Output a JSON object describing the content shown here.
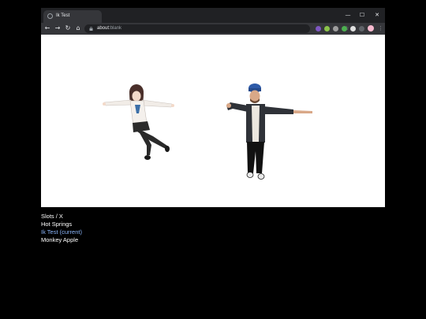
{
  "browser": {
    "tab_title": "Ik Test",
    "url_host": "about:",
    "url_path": "blank",
    "window_controls": {
      "minimize": "—",
      "maximize": "☐",
      "close": "✕"
    },
    "nav": {
      "back": "←",
      "forward": "→",
      "reload": "↻",
      "home": "⌂"
    },
    "star": "☆",
    "menu": "⋮",
    "extensions": [
      {
        "name": "ext-purple",
        "color": "#7e57c2"
      },
      {
        "name": "ext-green",
        "color": "#8bc34a"
      },
      {
        "name": "ext-gray",
        "color": "#9e9e9e"
      },
      {
        "name": "ext-green2",
        "color": "#4caf50"
      },
      {
        "name": "ext-white",
        "color": "#e0e0e0"
      },
      {
        "name": "ext-dark",
        "color": "#5f6368"
      },
      {
        "name": "ext-profile",
        "color": "#f8bbd0"
      }
    ]
  },
  "scene": {
    "background": "#ffffff",
    "avatars": [
      "anime-girl-avatar",
      "man-beanie-avatar"
    ]
  },
  "slots": {
    "header": "Slots / X",
    "items": [
      {
        "label": "Hot Springs",
        "current": false
      },
      {
        "label": "Ik Test (current)",
        "current": true
      },
      {
        "label": "Monkey Apple",
        "current": false
      }
    ]
  },
  "colors": {
    "page_bg": "#000000",
    "text": "#ffffff",
    "current_slot": "#8ab4f8",
    "chrome_dark": "#202124",
    "chrome_toolbar": "#35363a"
  }
}
